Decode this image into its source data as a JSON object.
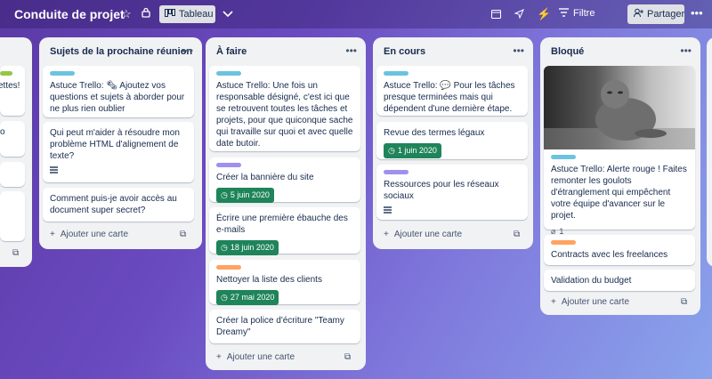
{
  "header": {
    "board_title": "Conduite de projet",
    "view_label": "Tableau",
    "filter_label": "Filtre",
    "share_label": "Partager"
  },
  "add_card_label": "Ajouter une carte",
  "lists": [
    {
      "title": "",
      "cards": [
        {
          "text": "ettes!",
          "label_color": "#94c748"
        },
        {
          "text": "o"
        },
        {
          "text": ""
        }
      ]
    },
    {
      "title": "Sujets de la prochaine réunion",
      "cards": [
        {
          "text": "Astuce Trello: 🗞 Ajoutez vos questions et sujets à aborder pour ne plus rien oublier",
          "label_color": "#6cc3e0"
        },
        {
          "text": "Qui peut m'aider à résoudre mon problème HTML d'alignement de texte?"
        },
        {
          "text": "Comment puis-je avoir accès au document super secret?"
        }
      ]
    },
    {
      "title": "À faire",
      "cards": [
        {
          "text": "Astuce Trello: Une fois un responsable désigné, c'est ici que se retrouvent toutes les tâches et projets, pour que quiconque sache qui travaille sur quoi et avec quelle date butoir.",
          "label_color": "#6cc3e0"
        },
        {
          "text": "Créer la bannière du site",
          "label_color": "#9f8fef",
          "date": "5 juin 2020"
        },
        {
          "text": "Écrire une première ébauche des e-mails",
          "date": "18 juin 2020"
        },
        {
          "text": "Nettoyer la liste des clients",
          "label_color": "#fea362",
          "date": "27 mai 2020"
        },
        {
          "text": "Créer la police d'écriture \"Teamy Dreamy\""
        }
      ]
    },
    {
      "title": "En cours",
      "cards": [
        {
          "text": "Astuce Trello: 💬 Pour les tâches presque terminées mais qui dépendent d'une dernière étape.",
          "label_color": "#6cc3e0"
        },
        {
          "text": "Revue des termes légaux",
          "date": "1 juin 2020"
        },
        {
          "text": "Ressources pour les réseaux sociaux",
          "label_color": "#9f8fef"
        }
      ]
    },
    {
      "title": "Bloqué",
      "cards": [
        {
          "text": "Astuce Trello: Alerte rouge ! Faites remonter les goulots d'étranglement qui empêchent votre équipe d'avancer sur le projet.",
          "label_color": "#6cc3e0",
          "attachments": "1"
        },
        {
          "text": "Contracts avec les freelances",
          "label_color": "#fea362"
        },
        {
          "text": "Validation du budget"
        }
      ]
    }
  ]
}
